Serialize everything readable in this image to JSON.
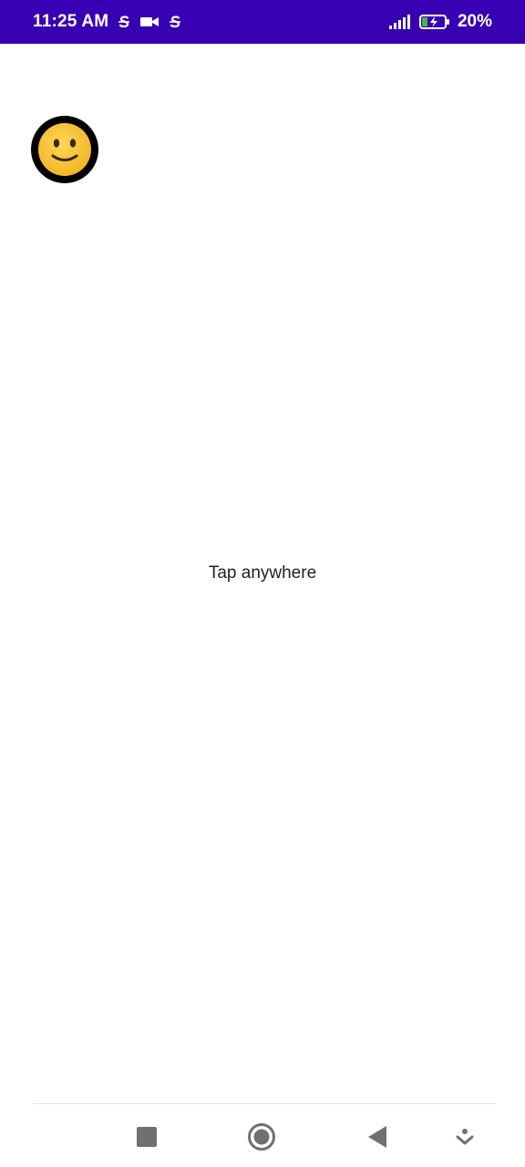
{
  "status_bar": {
    "time": "11:25 AM",
    "battery_percent": "20%",
    "icons_left": [
      "s-sync-icon",
      "video-camera-icon",
      "s-sync-icon"
    ],
    "icons_right": [
      "signal-bars-icon",
      "battery-charging-icon"
    ],
    "background_color": "#3700b3"
  },
  "main": {
    "emoji_icon": "slightly-smiling-face-icon",
    "instruction_text": "Tap anywhere"
  },
  "nav_bar": {
    "buttons": [
      "recents-square-icon",
      "home-circle-icon",
      "back-triangle-icon",
      "gesture-down-icon"
    ]
  }
}
